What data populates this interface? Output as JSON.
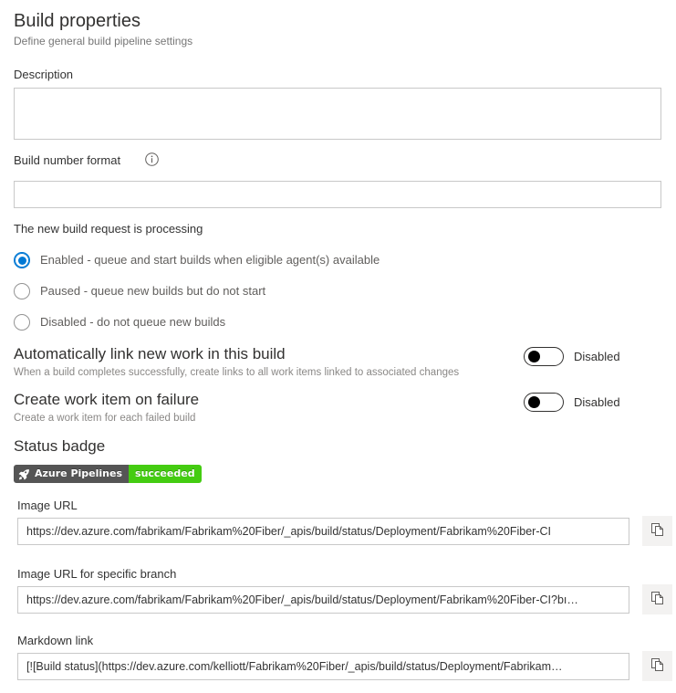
{
  "header": {
    "title": "Build properties",
    "subtitle": "Define general build pipeline settings"
  },
  "description": {
    "label": "Description",
    "value": "",
    "placeholder": ""
  },
  "build_number_format": {
    "label": "Build number format",
    "info_icon": "info-icon",
    "value": "",
    "placeholder": ""
  },
  "processing": {
    "label": "The new build request is processing",
    "selected": 0,
    "options": [
      {
        "label": "Enabled - queue and start builds when eligible agent(s) available"
      },
      {
        "label": "Paused - queue new builds but do not start"
      },
      {
        "label": "Disabled - do not queue new builds"
      }
    ]
  },
  "auto_link": {
    "heading": "Automatically link new work in this build",
    "subtext": "When a build completes successfully, create links to all work items linked to associated changes",
    "toggle_state": "Disabled"
  },
  "work_item_on_failure": {
    "heading": "Create work item on failure",
    "subtext": "Create a work item for each failed build",
    "toggle_state": "Disabled"
  },
  "status_badge": {
    "heading": "Status badge",
    "badge_icon": "rocket-icon",
    "badge_left_text": "Azure Pipelines",
    "badge_right_text": "succeeded",
    "badge_left_color": "#555555",
    "badge_right_color": "#44cc11"
  },
  "image_url": {
    "label": "Image URL",
    "value": "https://dev.azure.com/fabrikam/Fabrikam%20Fiber/_apis/build/status/Deployment/Fabrikam%20Fiber-CI",
    "copy_icon": "copy-icon"
  },
  "image_url_branch": {
    "label": "Image URL for specific branch",
    "value": "https://dev.azure.com/fabrikam/Fabrikam%20Fiber/_apis/build/status/Deployment/Fabrikam%20Fiber-CI?bı…",
    "copy_icon": "copy-icon"
  },
  "markdown_link": {
    "label": "Markdown link",
    "value": "[![Build status](https://dev.azure.com/kelliott/Fabrikam%20Fiber/_apis/build/status/Deployment/Fabrikam…",
    "copy_icon": "copy-icon"
  },
  "colors": {
    "accent": "#0078d4",
    "badge_green": "#44cc11",
    "badge_gray": "#555555"
  }
}
